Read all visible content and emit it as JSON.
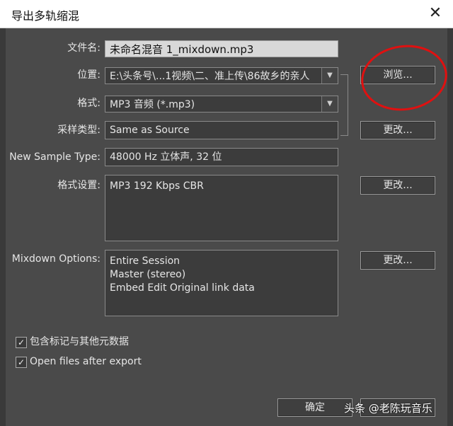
{
  "window": {
    "title": "导出多轨缩混",
    "close_glyph": "✕"
  },
  "form": {
    "filename_label": "文件名:",
    "filename_value": "未命名混音 1_mixdown.mp3",
    "location_label": "位置:",
    "location_value": "E:\\头条号\\...1视频\\二、准上传\\86故乡的亲人",
    "browse_label": "浏览...",
    "format_label": "格式:",
    "format_value": "MP3 音频 (*.mp3)",
    "sample_type_label": "采样类型:",
    "sample_type_value": "Same as Source",
    "sample_type_change": "更改...",
    "new_sample_type_label": "New Sample Type:",
    "new_sample_type_value": "48000 Hz 立体声, 32 位",
    "format_settings_label": "格式设置:",
    "format_settings_value": "MP3 192 Kbps CBR",
    "format_settings_change": "更改...",
    "mixdown_options_label": "Mixdown Options:",
    "mixdown_options_lines": [
      "Entire Session",
      "Master (stereo)",
      "Embed Edit Original link data"
    ],
    "mixdown_options_change": "更改..."
  },
  "checkboxes": [
    {
      "label": "包含标记与其他元数据",
      "checked": true
    },
    {
      "label": "Open files after export",
      "checked": true
    }
  ],
  "footer": {
    "ok_label": "确定"
  },
  "watermark": "头条 @老陈玩音乐",
  "colors": {
    "annotation_circle": "#e01010",
    "dialog_bg": "#4a4a4a"
  },
  "icons": {
    "dropdown": "chevron-down-icon",
    "checkbox": "checkmark-icon"
  }
}
